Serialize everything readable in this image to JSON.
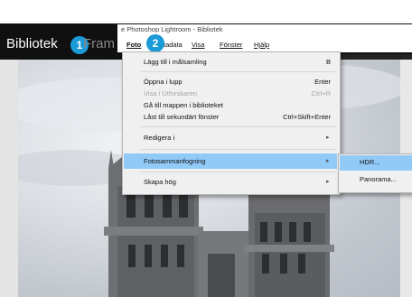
{
  "window": {
    "title": "e Photoshop Lightroom - Bibliotek"
  },
  "module": {
    "label": "Bibliotek",
    "next_label_partial": "Fram"
  },
  "badges": {
    "one": "1",
    "two": "2"
  },
  "menubar": {
    "items": [
      "Foto",
      "tadata",
      "Visa",
      "Fönster",
      "Hjälp"
    ]
  },
  "menu": {
    "items": [
      {
        "label": "Lägg till i målsamling",
        "shortcut": "B"
      },
      {
        "label": "Öppna i lupp",
        "shortcut": "Enter"
      },
      {
        "label": "Visa i Utforskaren",
        "shortcut": "Ctrl+R",
        "disabled": true
      },
      {
        "label": "Gå till mappen i biblioteket",
        "shortcut": ""
      },
      {
        "label": "Låst till sekundärt fönster",
        "shortcut": "Ctrl+Skift+Enter"
      },
      {
        "label": "Redigera i",
        "shortcut": ""
      },
      {
        "label": "Fotosammanfogning",
        "shortcut": "",
        "highlighted": true
      },
      {
        "label": "Skapa hög",
        "shortcut": ""
      }
    ]
  },
  "submenu": {
    "items": [
      {
        "label": "HDR...",
        "highlighted": true
      },
      {
        "label": "Panorama..."
      }
    ]
  },
  "colors": {
    "highlight": "#91c9f7",
    "badge": "#1a9bd7",
    "topbar": "#101010"
  }
}
